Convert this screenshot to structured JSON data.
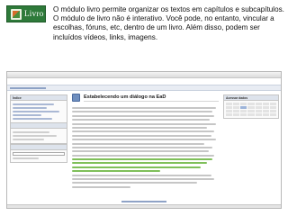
{
  "header": {
    "logo_text": "Livro",
    "description": "O módulo livro permite organizar os textos em  capítulos e subcapítulos. O módulo de livro não é interativo. Você pode, no entanto, vincular a escolhas, fóruns, etc, dentro de um livro. Além disso, podem ser incluídos vídeos, links, imagens."
  },
  "screenshot": {
    "content_title": "Estabelecendo um diálogo na EaD",
    "left_block_title": "Índice",
    "right_block_title": "Acessar dados",
    "colors": {
      "logo_green": "#2e7a3a",
      "moodle_blue": "#2a4c86",
      "highlight_green": "#7fbf5a"
    },
    "icons": [
      "book-logo-icon",
      "chapter-icon"
    ]
  }
}
